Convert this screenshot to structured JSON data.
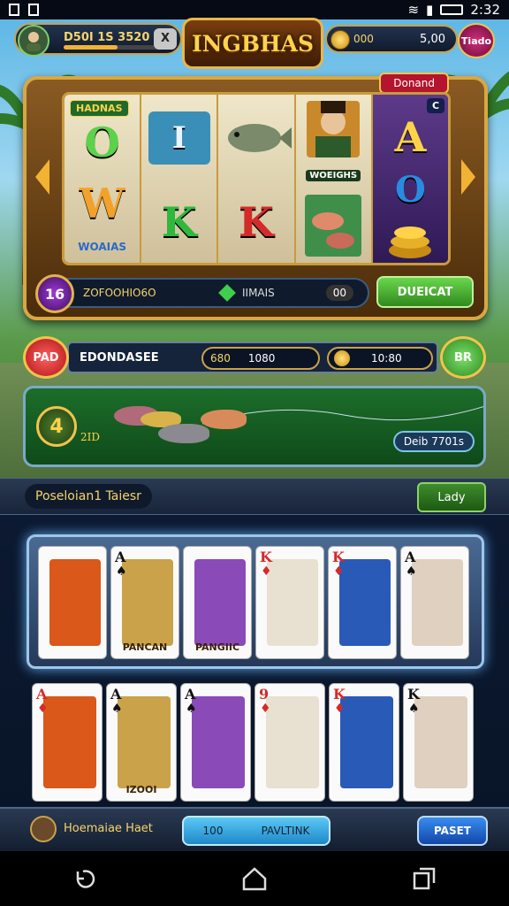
{
  "status_bar": {
    "time": "2:32"
  },
  "top": {
    "player_name": "D50I 1S 3520",
    "close_label": "X",
    "xp_fraction": 0.55,
    "logo_text": "INGBHAS",
    "coin_label": "000",
    "coin_amount": "5,00",
    "shop_label": "Tiado"
  },
  "slot": {
    "promo_label": "Donand",
    "reel1": {
      "badge": "HADNAS",
      "top_symbol": "O",
      "bottom_symbol": "W",
      "label": "WOAIAS"
    },
    "reel2": {
      "top_symbol": "I",
      "bottom_symbol": "K"
    },
    "reel3": {
      "label": "WOEIGHS",
      "bottom_symbol": "K"
    },
    "reel5": {
      "top_symbol": "A",
      "mid_symbol": "O",
      "corner_label": "C"
    },
    "level": "16",
    "info_text": "ZOFOOHIO6O",
    "gem_text": "IIMAIS",
    "counter": "00",
    "spin_label": "DUEICAT"
  },
  "bet_row": {
    "left_button": "PAD",
    "bet_label": "EDONDASEE",
    "value1_prefix": "680",
    "value1": "1080",
    "value2": "10:80",
    "right_button": "BR"
  },
  "fishing": {
    "badge": "4",
    "catch_number": "2ID",
    "value_label": "Deib 7701s"
  },
  "table": {
    "label": "Poseloian1 Taiesr",
    "leave_button": "Lady"
  },
  "hand_cards": [
    {
      "rank": "",
      "suit": "",
      "caption": ""
    },
    {
      "rank": "A",
      "suit": "♠",
      "caption": "PANCAN"
    },
    {
      "rank": "",
      "suit": "",
      "caption": "PANGIIC"
    },
    {
      "rank": "K",
      "suit": "♦",
      "caption": ""
    },
    {
      "rank": "K",
      "suit": "♦",
      "caption": ""
    },
    {
      "rank": "A",
      "suit": "♠",
      "caption": ""
    }
  ],
  "table_cards": [
    {
      "rank": "A",
      "suit": "♦",
      "caption": ""
    },
    {
      "rank": "A",
      "suit": "♠",
      "caption": "IZOOI"
    },
    {
      "rank": "A",
      "suit": "♠",
      "caption": ""
    },
    {
      "rank": "9",
      "suit": "♦",
      "caption": ""
    },
    {
      "rank": "K",
      "suit": "♦",
      "caption": ""
    },
    {
      "rank": "K",
      "suit": "♠",
      "caption": ""
    }
  ],
  "footer": {
    "label": "Hoemaiae Haet",
    "value": "100",
    "pill_label": "PAVLTINK",
    "button": "PASET"
  },
  "colors": {
    "gold": "#f1c34e",
    "green": "#3fce4e",
    "red": "#d42a2a",
    "blue": "#1e88c9"
  }
}
